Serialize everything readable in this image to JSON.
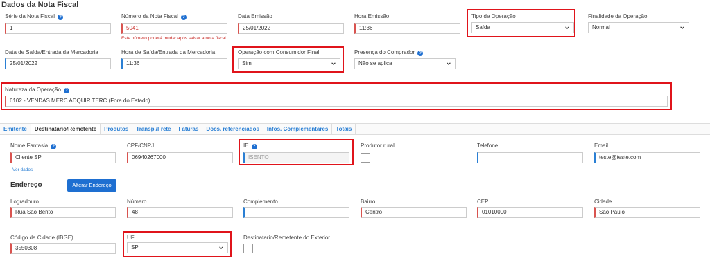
{
  "section_title": "Dados da Nota Fiscal",
  "fields": {
    "serie": {
      "label": "Série da Nota Fiscal",
      "value": "1"
    },
    "numero": {
      "label": "Número da Nota Fiscal",
      "value": "5041",
      "hint": "Este número poderá mudar após salvar a nota fiscal"
    },
    "data_emissao": {
      "label": "Data Emissão",
      "value": "25/01/2022"
    },
    "hora_emissao": {
      "label": "Hora Emissão",
      "value": "11:36"
    },
    "tipo_operacao": {
      "label": "Tipo de Operação",
      "value": "Saída"
    },
    "finalidade": {
      "label": "Finalidade da Operação",
      "value": "Normal"
    },
    "data_saida": {
      "label": "Data de Saída/Entrada da Mercadoria",
      "value": "25/01/2022"
    },
    "hora_saida": {
      "label": "Hora de Saída/Entrada da Mercadoria",
      "value": "11:36"
    },
    "consumidor_final": {
      "label": "Operação com Consumidor Final",
      "value": "Sim"
    },
    "presenca": {
      "label": "Presença do Comprador",
      "value": "Não se aplica"
    },
    "natureza": {
      "label": "Natureza da Operação",
      "value": "6102 - VENDAS MERC ADQUIR TERC (Fora do Estado)"
    }
  },
  "tabs": [
    "Emitente",
    "Destinatario/Remetente",
    "Produtos",
    "Transp./Frete",
    "Faturas",
    "Docs. referenciados",
    "Infos. Complementares",
    "Totais"
  ],
  "dest": {
    "nome_fantasia": {
      "label": "Nome Fantasia",
      "value": "Cliente SP"
    },
    "ver_dados": "Ver dados",
    "cpf_cnpj": {
      "label": "CPF/CNPJ",
      "value": "06940267000"
    },
    "ie": {
      "label": "IE",
      "value": "ISENTO"
    },
    "produtor_rural": {
      "label": "Produtor rural"
    },
    "telefone": {
      "label": "Telefone",
      "value": ""
    },
    "email": {
      "label": "Email",
      "value": "teste@teste.com"
    }
  },
  "endereco": {
    "title": "Endereço",
    "alterar_button": "Alterar Endereço",
    "logradouro": {
      "label": "Logradouro",
      "value": "Rua São Bento"
    },
    "numero": {
      "label": "Número",
      "value": "48"
    },
    "complemento": {
      "label": "Complemento",
      "value": ""
    },
    "bairro": {
      "label": "Bairro",
      "value": "Centro"
    },
    "cep": {
      "label": "CEP",
      "value": "01010000"
    },
    "cidade": {
      "label": "Cidade",
      "value": "São Paulo"
    },
    "codigo_cidade": {
      "label": "Código da Cidade (IBGE)",
      "value": "3550308"
    },
    "uf": {
      "label": "UF",
      "value": "SP"
    },
    "exterior": {
      "label": "Destinatario/Remetente do Exterior"
    }
  },
  "colors": {
    "highlight": "#e0141b",
    "accent": "#1e6fd1",
    "required": "#d9534f"
  }
}
